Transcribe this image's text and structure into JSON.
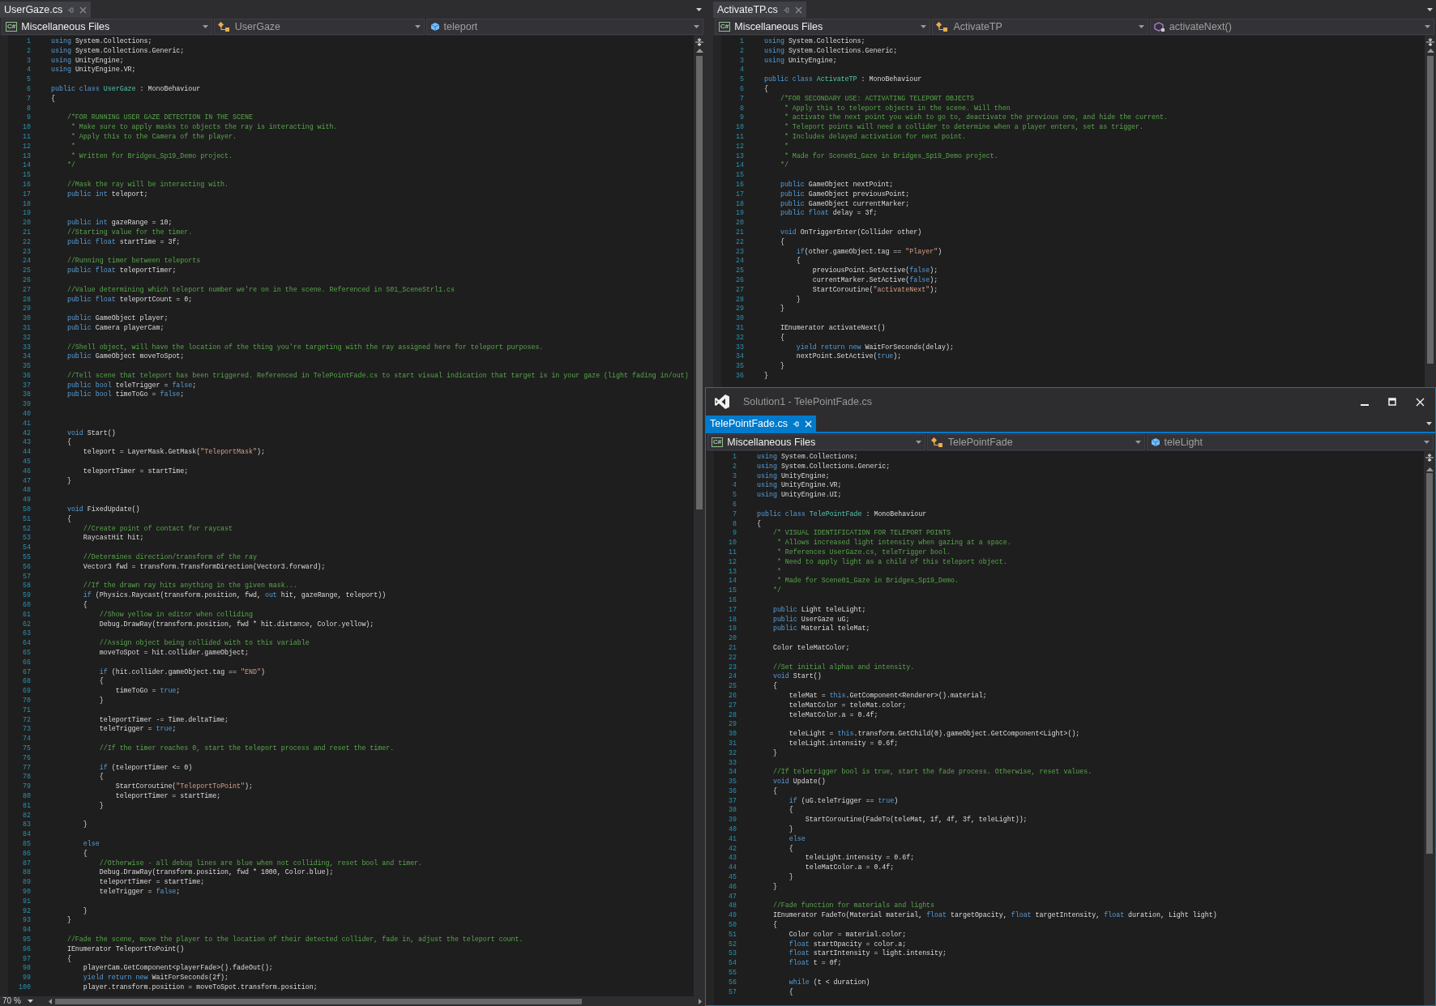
{
  "left_editor": {
    "tab": {
      "label": "UserGaze.cs",
      "selected": false
    },
    "nav": {
      "project_badge": "C#",
      "project": "Miscellaneous Files",
      "type": "UserGaze",
      "member": {
        "kind": "field",
        "label": "teleport"
      }
    },
    "lines": [
      {
        "number": "1",
        "segments": [
          {
            "kind": "keyword",
            "text": "using"
          },
          {
            "kind": "plain",
            "text": " System.Collections;"
          }
        ]
      },
      {
        "number": "2",
        "segments": [
          {
            "kind": "keyword",
            "text": "using"
          },
          {
            "kind": "plain",
            "text": " System.Collections.Generic;"
          }
        ]
      },
      {
        "number": "3",
        "segments": [
          {
            "kind": "keyword",
            "text": "using"
          },
          {
            "kind": "plain",
            "text": " UnityEngine;"
          }
        ]
      },
      {
        "number": "4",
        "segments": [
          {
            "kind": "keyword",
            "text": "using"
          },
          {
            "kind": "plain",
            "text": " UnityEngine.VR;"
          }
        ]
      },
      {
        "number": "5"
      },
      {
        "number": "6",
        "segments": [
          {
            "kind": "keyword",
            "text": "public class "
          },
          {
            "kind": "type",
            "text": "UserGaze"
          },
          {
            "kind": "plain",
            "text": " : MonoBehaviour"
          }
        ]
      },
      {
        "number": "7",
        "segments": [
          {
            "kind": "plain",
            "text": "{"
          }
        ]
      },
      {
        "number": "8"
      },
      {
        "number": "9",
        "segments": [
          {
            "kind": "comment",
            "text": "    /*FOR RUNNING USER GAZE DETECTION IN THE SCENE"
          }
        ]
      },
      {
        "number": "10",
        "segments": [
          {
            "kind": "comment",
            "text": "     * Make sure to apply masks to objects the ray is interacting with."
          }
        ]
      },
      {
        "number": "11",
        "segments": [
          {
            "kind": "comment",
            "text": "     * Apply this to the Camera of the player."
          }
        ]
      },
      {
        "number": "12",
        "segments": [
          {
            "kind": "comment",
            "text": "     *"
          }
        ]
      },
      {
        "number": "13",
        "segments": [
          {
            "kind": "comment",
            "text": "     * Written for Bridges_Sp19_Demo project."
          }
        ]
      },
      {
        "number": "14",
        "segments": [
          {
            "kind": "comment",
            "text": "    */"
          }
        ]
      },
      {
        "number": "15"
      },
      {
        "number": "16",
        "segments": [
          {
            "kind": "comment",
            "text": "    //Mask the ray will be interacting with."
          }
        ]
      },
      {
        "number": "17",
        "segments": [
          {
            "kind": "keyword",
            "text": "    public int"
          },
          {
            "kind": "plain",
            "text": " teleport;"
          }
        ]
      },
      {
        "number": "18"
      },
      {
        "number": "19"
      },
      {
        "number": "20",
        "segments": [
          {
            "kind": "keyword",
            "text": "    public int"
          },
          {
            "kind": "plain",
            "text": " gazeRange = 10;"
          }
        ]
      },
      {
        "number": "21",
        "segments": [
          {
            "kind": "comment",
            "text": "    //Starting value for the timer."
          }
        ]
      },
      {
        "number": "22",
        "segments": [
          {
            "kind": "keyword",
            "text": "    public float"
          },
          {
            "kind": "plain",
            "text": " startTime = 3f;"
          }
        ]
      },
      {
        "number": "23"
      },
      {
        "number": "24",
        "segments": [
          {
            "kind": "comment",
            "text": "    //Running timer between teleports"
          }
        ]
      },
      {
        "number": "25",
        "segments": [
          {
            "kind": "keyword",
            "text": "    public float"
          },
          {
            "kind": "plain",
            "text": " teleportTimer;"
          }
        ]
      },
      {
        "number": "26"
      },
      {
        "number": "27",
        "segments": [
          {
            "kind": "comment",
            "text": "    //Value determining which teleport number we're on in the scene. Referenced in S01_SceneStrl1.cs"
          }
        ]
      },
      {
        "number": "28",
        "segments": [
          {
            "kind": "keyword",
            "text": "    public float"
          },
          {
            "kind": "plain",
            "text": " teleportCount = 0;"
          }
        ]
      },
      {
        "number": "29"
      },
      {
        "number": "30",
        "segments": [
          {
            "kind": "keyword",
            "text": "    public"
          },
          {
            "kind": "plain",
            "text": " GameObject player;"
          }
        ]
      },
      {
        "number": "31",
        "segments": [
          {
            "kind": "keyword",
            "text": "    public"
          },
          {
            "kind": "plain",
            "text": " Camera playerCam;"
          }
        ]
      },
      {
        "number": "32"
      },
      {
        "number": "33",
        "segments": [
          {
            "kind": "comment",
            "text": "    //Shell object, will have the location of the thing you're targeting with the ray assigned here for teleport purposes."
          }
        ]
      },
      {
        "number": "34",
        "segments": [
          {
            "kind": "keyword",
            "text": "    public"
          },
          {
            "kind": "plain",
            "text": " GameObject moveToSpot;"
          }
        ]
      },
      {
        "number": "35"
      },
      {
        "number": "36",
        "segments": [
          {
            "kind": "comment",
            "text": "    //Tell scene that teleport has been triggered. Referenced in TelePointFade.cs to start visual indication that target is in your gaze (light fading in/out)"
          }
        ]
      },
      {
        "number": "37",
        "segments": [
          {
            "kind": "keyword",
            "text": "    public bool"
          },
          {
            "kind": "plain",
            "text": " teleTrigger = "
          },
          {
            "kind": "keyword",
            "text": "false"
          },
          {
            "kind": "plain",
            "text": ";"
          }
        ]
      },
      {
        "number": "38",
        "segments": [
          {
            "kind": "keyword",
            "text": "    public bool"
          },
          {
            "kind": "plain",
            "text": " timeToGo = "
          },
          {
            "kind": "keyword",
            "text": "false"
          },
          {
            "kind": "plain",
            "text": ";"
          }
        ]
      },
      {
        "number": "39"
      },
      {
        "number": "40"
      },
      {
        "number": "41"
      },
      {
        "number": "42",
        "segments": [
          {
            "kind": "keyword",
            "text": "    void"
          },
          {
            "kind": "plain",
            "text": " Start()"
          }
        ]
      },
      {
        "number": "43",
        "segments": [
          {
            "kind": "plain",
            "text": "    {"
          }
        ]
      },
      {
        "number": "44",
        "segments": [
          {
            "kind": "plain",
            "text": "        teleport = LayerMask.GetMask("
          },
          {
            "kind": "string",
            "text": "\"TeleportMask\""
          },
          {
            "kind": "plain",
            "text": ");"
          }
        ]
      },
      {
        "number": "45"
      },
      {
        "number": "46",
        "segments": [
          {
            "kind": "plain",
            "text": "        teleportTimer = startTime;"
          }
        ]
      },
      {
        "number": "47",
        "segments": [
          {
            "kind": "plain",
            "text": "    }"
          }
        ]
      },
      {
        "number": "48"
      },
      {
        "number": "49"
      },
      {
        "number": "50",
        "segments": [
          {
            "kind": "keyword",
            "text": "    void"
          },
          {
            "kind": "plain",
            "text": " FixedUpdate()"
          }
        ]
      },
      {
        "number": "51",
        "segments": [
          {
            "kind": "plain",
            "text": "    {"
          }
        ]
      },
      {
        "number": "52",
        "segments": [
          {
            "kind": "comment",
            "text": "        //Create point of contact for raycast"
          }
        ]
      },
      {
        "number": "53",
        "segments": [
          {
            "kind": "plain",
            "text": "        RaycastHit hit;"
          }
        ]
      },
      {
        "number": "54"
      },
      {
        "number": "55",
        "segments": [
          {
            "kind": "comment",
            "text": "        //Determines direction/transform of the ray"
          }
        ]
      },
      {
        "number": "56",
        "segments": [
          {
            "kind": "plain",
            "text": "        Vector3 fwd = transform.TransformDirection(Vector3.forward);"
          }
        ]
      },
      {
        "number": "57"
      },
      {
        "number": "58",
        "segments": [
          {
            "kind": "comment",
            "text": "        //If the drawn ray hits anything in the given mask..."
          }
        ]
      },
      {
        "number": "59",
        "segments": [
          {
            "kind": "keyword",
            "text": "        if"
          },
          {
            "kind": "plain",
            "text": " (Physics.Raycast(transform.position, fwd, "
          },
          {
            "kind": "keyword",
            "text": "out"
          },
          {
            "kind": "plain",
            "text": " hit, gazeRange, teleport))"
          }
        ]
      },
      {
        "number": "60",
        "segments": [
          {
            "kind": "plain",
            "text": "        {"
          }
        ]
      },
      {
        "number": "61",
        "segments": [
          {
            "kind": "comment",
            "text": "            //Show yellow in editor when colliding"
          }
        ]
      },
      {
        "number": "62",
        "segments": [
          {
            "kind": "plain",
            "text": "            Debug.DrawRay(transform.position, fwd * hit.distance, Color.yellow);"
          }
        ]
      },
      {
        "number": "63"
      },
      {
        "number": "64",
        "segments": [
          {
            "kind": "comment",
            "text": "            //Assign object being collided with to this variable"
          }
        ]
      },
      {
        "number": "65",
        "segments": [
          {
            "kind": "plain",
            "text": "            moveToSpot = hit.collider.gameObject;"
          }
        ]
      },
      {
        "number": "66"
      },
      {
        "number": "67",
        "segments": [
          {
            "kind": "keyword",
            "text": "            if"
          },
          {
            "kind": "plain",
            "text": " (hit.collider.gameObject.tag == "
          },
          {
            "kind": "string",
            "text": "\"END\""
          },
          {
            "kind": "plain",
            "text": ")"
          }
        ]
      },
      {
        "number": "68",
        "segments": [
          {
            "kind": "plain",
            "text": "            {"
          }
        ]
      },
      {
        "number": "69",
        "segments": [
          {
            "kind": "plain",
            "text": "                timeToGo = "
          },
          {
            "kind": "keyword",
            "text": "true"
          },
          {
            "kind": "plain",
            "text": ";"
          }
        ]
      },
      {
        "number": "70",
        "segments": [
          {
            "kind": "plain",
            "text": "            }"
          }
        ]
      },
      {
        "number": "71"
      },
      {
        "number": "72",
        "segments": [
          {
            "kind": "plain",
            "text": "            teleportTimer -= Time.deltaTime;"
          }
        ]
      },
      {
        "number": "73",
        "segments": [
          {
            "kind": "plain",
            "text": "            teleTrigger = "
          },
          {
            "kind": "keyword",
            "text": "true"
          },
          {
            "kind": "plain",
            "text": ";"
          }
        ]
      },
      {
        "number": "74"
      },
      {
        "number": "75",
        "segments": [
          {
            "kind": "comment",
            "text": "            //If the timer reaches 0, start the teleport process and reset the timer."
          }
        ]
      },
      {
        "number": "76"
      },
      {
        "number": "77",
        "segments": [
          {
            "kind": "keyword",
            "text": "            if"
          },
          {
            "kind": "plain",
            "text": " (teleportTimer <= 0)"
          }
        ]
      },
      {
        "number": "78",
        "segments": [
          {
            "kind": "plain",
            "text": "            {"
          }
        ]
      },
      {
        "number": "79",
        "segments": [
          {
            "kind": "plain",
            "text": "                StartCoroutine("
          },
          {
            "kind": "string",
            "text": "\"TeleportToPoint\""
          },
          {
            "kind": "plain",
            "text": ");"
          }
        ]
      },
      {
        "number": "80",
        "segments": [
          {
            "kind": "plain",
            "text": "                teleportTimer = startTime;"
          }
        ]
      },
      {
        "number": "81",
        "segments": [
          {
            "kind": "plain",
            "text": "            }"
          }
        ]
      },
      {
        "number": "82"
      },
      {
        "number": "83",
        "segments": [
          {
            "kind": "plain",
            "text": "        }"
          }
        ]
      },
      {
        "number": "84"
      },
      {
        "number": "85",
        "segments": [
          {
            "kind": "keyword",
            "text": "        else"
          }
        ]
      },
      {
        "number": "86",
        "segments": [
          {
            "kind": "plain",
            "text": "        {"
          }
        ]
      },
      {
        "number": "87",
        "segments": [
          {
            "kind": "comment",
            "text": "            //Otherwise - all debug lines are blue when not colliding, reset bool and timer."
          }
        ]
      },
      {
        "number": "88",
        "segments": [
          {
            "kind": "plain",
            "text": "            Debug.DrawRay(transform.position, fwd * 1000, Color.blue);"
          }
        ]
      },
      {
        "number": "89",
        "segments": [
          {
            "kind": "plain",
            "text": "            teleportTimer = startTime;"
          }
        ]
      },
      {
        "number": "90",
        "segments": [
          {
            "kind": "plain",
            "text": "            teleTrigger = "
          },
          {
            "kind": "keyword",
            "text": "false"
          },
          {
            "kind": "plain",
            "text": ";"
          }
        ]
      },
      {
        "number": "91"
      },
      {
        "number": "92",
        "segments": [
          {
            "kind": "plain",
            "text": "        }"
          }
        ]
      },
      {
        "number": "93",
        "segments": [
          {
            "kind": "plain",
            "text": "    }"
          }
        ]
      },
      {
        "number": "94"
      },
      {
        "number": "95",
        "segments": [
          {
            "kind": "comment",
            "text": "    //Fade the scene, move the player to the location of their detected collider, fade in, adjust the teleport count."
          }
        ]
      },
      {
        "number": "96",
        "segments": [
          {
            "kind": "plain",
            "text": "    IEnumerator TeleportToPoint()"
          }
        ]
      },
      {
        "number": "97",
        "segments": [
          {
            "kind": "plain",
            "text": "    {"
          }
        ]
      },
      {
        "number": "98",
        "segments": [
          {
            "kind": "plain",
            "text": "        playerCam.GetComponent<playerFade>().fadeOut();"
          }
        ]
      },
      {
        "number": "99",
        "segments": [
          {
            "kind": "keyword",
            "text": "        yield return new"
          },
          {
            "kind": "plain",
            "text": " WaitForSeconds(2f);"
          }
        ]
      },
      {
        "number": "100",
        "segments": [
          {
            "kind": "plain",
            "text": "        player.transform.position = moveToSpot.transform.position;"
          }
        ]
      }
    ],
    "zoom": "70 %"
  },
  "right_editor": {
    "tab": {
      "label": "ActivateTP.cs",
      "selected": false
    },
    "nav": {
      "project_badge": "C#",
      "project": "Miscellaneous Files",
      "type": "ActivateTP",
      "member": {
        "kind": "method",
        "label": "activateNext()"
      }
    },
    "lines": [
      {
        "number": "1",
        "segments": [
          {
            "kind": "keyword",
            "text": "using"
          },
          {
            "kind": "plain",
            "text": " System.Collections;"
          }
        ]
      },
      {
        "number": "2",
        "segments": [
          {
            "kind": "keyword",
            "text": "using"
          },
          {
            "kind": "plain",
            "text": " System.Collections.Generic;"
          }
        ]
      },
      {
        "number": "3",
        "segments": [
          {
            "kind": "keyword",
            "text": "using"
          },
          {
            "kind": "plain",
            "text": " UnityEngine;"
          }
        ]
      },
      {
        "number": "4"
      },
      {
        "number": "5",
        "segments": [
          {
            "kind": "keyword",
            "text": "public class "
          },
          {
            "kind": "type",
            "text": "ActivateTP"
          },
          {
            "kind": "plain",
            "text": " : MonoBehaviour"
          }
        ]
      },
      {
        "number": "6",
        "segments": [
          {
            "kind": "plain",
            "text": "{"
          }
        ]
      },
      {
        "number": "7",
        "segments": [
          {
            "kind": "comment",
            "text": "    /*FOR SECONDARY USE: ACTIVATING TELEPORT OBJECTS"
          }
        ]
      },
      {
        "number": "8",
        "segments": [
          {
            "kind": "comment",
            "text": "     * Apply this to teleport objects in the scene. Will then"
          }
        ]
      },
      {
        "number": "9",
        "segments": [
          {
            "kind": "comment",
            "text": "     * activate the next point you wish to go to, deactivate the previous one, and hide the current."
          }
        ]
      },
      {
        "number": "10",
        "segments": [
          {
            "kind": "comment",
            "text": "     * Teleport points will need a collider to determine when a player enters, set as trigger."
          }
        ]
      },
      {
        "number": "11",
        "segments": [
          {
            "kind": "comment",
            "text": "     * Includes delayed activation for next point."
          }
        ]
      },
      {
        "number": "12",
        "segments": [
          {
            "kind": "comment",
            "text": "     *"
          }
        ]
      },
      {
        "number": "13",
        "segments": [
          {
            "kind": "comment",
            "text": "     * Made for Scene01_Gaze in Bridges_Sp19_Demo project."
          }
        ]
      },
      {
        "number": "14",
        "segments": [
          {
            "kind": "comment",
            "text": "    */"
          }
        ]
      },
      {
        "number": "15"
      },
      {
        "number": "16",
        "segments": [
          {
            "kind": "keyword",
            "text": "    public"
          },
          {
            "kind": "plain",
            "text": " GameObject nextPoint;"
          }
        ]
      },
      {
        "number": "17",
        "segments": [
          {
            "kind": "keyword",
            "text": "    public"
          },
          {
            "kind": "plain",
            "text": " GameObject previousPoint;"
          }
        ]
      },
      {
        "number": "18",
        "segments": [
          {
            "kind": "keyword",
            "text": "    public"
          },
          {
            "kind": "plain",
            "text": " GameObject currentMarker;"
          }
        ]
      },
      {
        "number": "19",
        "segments": [
          {
            "kind": "keyword",
            "text": "    public float"
          },
          {
            "kind": "plain",
            "text": " delay = 3f;"
          }
        ]
      },
      {
        "number": "20"
      },
      {
        "number": "21",
        "segments": [
          {
            "kind": "keyword",
            "text": "    void"
          },
          {
            "kind": "plain",
            "text": " OnTriggerEnter(Collider other)"
          }
        ]
      },
      {
        "number": "22",
        "segments": [
          {
            "kind": "plain",
            "text": "    {"
          }
        ]
      },
      {
        "number": "23",
        "segments": [
          {
            "kind": "keyword",
            "text": "        if"
          },
          {
            "kind": "plain",
            "text": "(other.gameObject.tag == "
          },
          {
            "kind": "string",
            "text": "\"Player\""
          },
          {
            "kind": "plain",
            "text": ")"
          }
        ]
      },
      {
        "number": "24",
        "segments": [
          {
            "kind": "plain",
            "text": "        {"
          }
        ]
      },
      {
        "number": "25",
        "segments": [
          {
            "kind": "plain",
            "text": "            previousPoint.SetActive("
          },
          {
            "kind": "keyword",
            "text": "false"
          },
          {
            "kind": "plain",
            "text": ");"
          }
        ]
      },
      {
        "number": "26",
        "segments": [
          {
            "kind": "plain",
            "text": "            currentMarker.SetActive("
          },
          {
            "kind": "keyword",
            "text": "false"
          },
          {
            "kind": "plain",
            "text": ");"
          }
        ]
      },
      {
        "number": "27",
        "segments": [
          {
            "kind": "plain",
            "text": "            StartCoroutine("
          },
          {
            "kind": "string",
            "text": "\"activateNext\""
          },
          {
            "kind": "plain",
            "text": ");"
          }
        ]
      },
      {
        "number": "28",
        "segments": [
          {
            "kind": "plain",
            "text": "        }"
          }
        ]
      },
      {
        "number": "29",
        "segments": [
          {
            "kind": "plain",
            "text": "    }"
          }
        ]
      },
      {
        "number": "30"
      },
      {
        "number": "31",
        "segments": [
          {
            "kind": "plain",
            "text": "    IEnumerator activateNext()"
          }
        ]
      },
      {
        "number": "32",
        "segments": [
          {
            "kind": "plain",
            "text": "    {"
          }
        ]
      },
      {
        "number": "33",
        "segments": [
          {
            "kind": "keyword",
            "text": "        yield return new"
          },
          {
            "kind": "plain",
            "text": " WaitForSeconds(delay);"
          }
        ]
      },
      {
        "number": "34",
        "segments": [
          {
            "kind": "plain",
            "text": "        nextPoint.SetActive("
          },
          {
            "kind": "keyword",
            "text": "true"
          },
          {
            "kind": "plain",
            "text": ");"
          }
        ]
      },
      {
        "number": "35",
        "segments": [
          {
            "kind": "plain",
            "text": "    }"
          }
        ]
      },
      {
        "number": "36",
        "segments": [
          {
            "kind": "plain",
            "text": "}"
          }
        ]
      }
    ]
  },
  "floating_window": {
    "title": "Solution1 - TelePointFade.cs",
    "editor": {
      "tab": {
        "label": "TelePointFade.cs",
        "selected": true
      },
      "nav": {
        "project_badge": "C#",
        "project": "Miscellaneous Files",
        "type": "TelePointFade",
        "member": {
          "kind": "field",
          "label": "teleLight"
        }
      },
      "lines": [
        {
          "number": "1",
          "segments": [
            {
              "kind": "keyword",
              "text": "using"
            },
            {
              "kind": "plain",
              "text": " System.Collections;"
            }
          ]
        },
        {
          "number": "2",
          "segments": [
            {
              "kind": "keyword",
              "text": "using"
            },
            {
              "kind": "plain",
              "text": " System.Collections.Generic;"
            }
          ]
        },
        {
          "number": "3",
          "segments": [
            {
              "kind": "keyword",
              "text": "using"
            },
            {
              "kind": "plain",
              "text": " UnityEngine;"
            }
          ]
        },
        {
          "number": "4",
          "segments": [
            {
              "kind": "keyword",
              "text": "using"
            },
            {
              "kind": "plain",
              "text": " UnityEngine.VR;"
            }
          ]
        },
        {
          "number": "5",
          "segments": [
            {
              "kind": "keyword",
              "text": "using"
            },
            {
              "kind": "plain",
              "text": " UnityEngine.UI;"
            }
          ]
        },
        {
          "number": "6"
        },
        {
          "number": "7",
          "segments": [
            {
              "kind": "keyword",
              "text": "public class "
            },
            {
              "kind": "type",
              "text": "TelePointFade"
            },
            {
              "kind": "plain",
              "text": " : MonoBehaviour"
            }
          ]
        },
        {
          "number": "8",
          "segments": [
            {
              "kind": "plain",
              "text": "{"
            }
          ]
        },
        {
          "number": "9",
          "segments": [
            {
              "kind": "comment",
              "text": "    /* VISUAL IDENTIFICATION FOR TELEPORT POINTS"
            }
          ]
        },
        {
          "number": "10",
          "segments": [
            {
              "kind": "comment",
              "text": "     * Allows increased light intensity when gazing at a space."
            }
          ]
        },
        {
          "number": "11",
          "segments": [
            {
              "kind": "comment",
              "text": "     * References UserGaze.cs, teleTrigger bool."
            }
          ]
        },
        {
          "number": "12",
          "segments": [
            {
              "kind": "comment",
              "text": "     * Need to apply light as a child of this teleport object."
            }
          ]
        },
        {
          "number": "13",
          "segments": [
            {
              "kind": "comment",
              "text": "     *"
            }
          ]
        },
        {
          "number": "14",
          "segments": [
            {
              "kind": "comment",
              "text": "     * Made for Scene01_Gaze in Bridges_Sp19_Demo."
            }
          ]
        },
        {
          "number": "15",
          "segments": [
            {
              "kind": "comment",
              "text": "    */"
            }
          ]
        },
        {
          "number": "16"
        },
        {
          "number": "17",
          "segments": [
            {
              "kind": "keyword",
              "text": "    public"
            },
            {
              "kind": "plain",
              "text": " Light teleLight;"
            }
          ]
        },
        {
          "number": "18",
          "segments": [
            {
              "kind": "keyword",
              "text": "    public"
            },
            {
              "kind": "plain",
              "text": " UserGaze uG;"
            }
          ]
        },
        {
          "number": "19",
          "segments": [
            {
              "kind": "keyword",
              "text": "    public"
            },
            {
              "kind": "plain",
              "text": " Material teleMat;"
            }
          ]
        },
        {
          "number": "20"
        },
        {
          "number": "21",
          "segments": [
            {
              "kind": "plain",
              "text": "    Color teleMatColor;"
            }
          ]
        },
        {
          "number": "22"
        },
        {
          "number": "23",
          "segments": [
            {
              "kind": "comment",
              "text": "    //Set initial alphas and intensity."
            }
          ]
        },
        {
          "number": "24",
          "segments": [
            {
              "kind": "keyword",
              "text": "    void"
            },
            {
              "kind": "plain",
              "text": " Start()"
            }
          ]
        },
        {
          "number": "25",
          "segments": [
            {
              "kind": "plain",
              "text": "    {"
            }
          ]
        },
        {
          "number": "26",
          "segments": [
            {
              "kind": "plain",
              "text": "        teleMat = "
            },
            {
              "kind": "keyword",
              "text": "this"
            },
            {
              "kind": "plain",
              "text": ".GetComponent<Renderer>().material;"
            }
          ]
        },
        {
          "number": "27",
          "segments": [
            {
              "kind": "plain",
              "text": "        teleMatColor = teleMat.color;"
            }
          ]
        },
        {
          "number": "28",
          "segments": [
            {
              "kind": "plain",
              "text": "        teleMatColor.a = 0.4f;"
            }
          ]
        },
        {
          "number": "29"
        },
        {
          "number": "30",
          "segments": [
            {
              "kind": "plain",
              "text": "        teleLight = "
            },
            {
              "kind": "keyword",
              "text": "this"
            },
            {
              "kind": "plain",
              "text": ".transform.GetChild(0).gameObject.GetComponent<Light>();"
            }
          ]
        },
        {
          "number": "31",
          "segments": [
            {
              "kind": "plain",
              "text": "        teleLight.intensity = 0.6f;"
            }
          ]
        },
        {
          "number": "32",
          "segments": [
            {
              "kind": "plain",
              "text": "    }"
            }
          ]
        },
        {
          "number": "33"
        },
        {
          "number": "34",
          "segments": [
            {
              "kind": "comment",
              "text": "    //If teletrigger bool is true, start the fade process. Otherwise, reset values."
            }
          ]
        },
        {
          "number": "35",
          "segments": [
            {
              "kind": "keyword",
              "text": "    void"
            },
            {
              "kind": "plain",
              "text": " Update()"
            }
          ]
        },
        {
          "number": "36",
          "segments": [
            {
              "kind": "plain",
              "text": "    {"
            }
          ]
        },
        {
          "number": "37",
          "segments": [
            {
              "kind": "keyword",
              "text": "        if"
            },
            {
              "kind": "plain",
              "text": " (uG.teleTrigger == "
            },
            {
              "kind": "keyword",
              "text": "true"
            },
            {
              "kind": "plain",
              "text": ")"
            }
          ]
        },
        {
          "number": "38",
          "segments": [
            {
              "kind": "plain",
              "text": "        {"
            }
          ]
        },
        {
          "number": "39",
          "segments": [
            {
              "kind": "plain",
              "text": "            StartCoroutine(FadeTo(teleMat, 1f, 4f, 3f, teleLight));"
            }
          ]
        },
        {
          "number": "40",
          "segments": [
            {
              "kind": "plain",
              "text": "        }"
            }
          ]
        },
        {
          "number": "41",
          "segments": [
            {
              "kind": "keyword",
              "text": "        else"
            }
          ]
        },
        {
          "number": "42",
          "segments": [
            {
              "kind": "plain",
              "text": "        {"
            }
          ]
        },
        {
          "number": "43",
          "segments": [
            {
              "kind": "plain",
              "text": "            teleLight.intensity = 0.6f;"
            }
          ]
        },
        {
          "number": "44",
          "segments": [
            {
              "kind": "plain",
              "text": "            teleMatColor.a = 0.4f;"
            }
          ]
        },
        {
          "number": "45",
          "segments": [
            {
              "kind": "plain",
              "text": "        }"
            }
          ]
        },
        {
          "number": "46",
          "segments": [
            {
              "kind": "plain",
              "text": "    }"
            }
          ]
        },
        {
          "number": "47"
        },
        {
          "number": "48",
          "segments": [
            {
              "kind": "comment",
              "text": "    //Fade function for materials and lights"
            }
          ]
        },
        {
          "number": "49",
          "segments": [
            {
              "kind": "plain",
              "text": "    IEnumerator FadeTo(Material material, "
            },
            {
              "kind": "keyword",
              "text": "float"
            },
            {
              "kind": "plain",
              "text": " targetOpacity, "
            },
            {
              "kind": "keyword",
              "text": "float"
            },
            {
              "kind": "plain",
              "text": " targetIntensity, "
            },
            {
              "kind": "keyword",
              "text": "float"
            },
            {
              "kind": "plain",
              "text": " duration, Light light)"
            }
          ]
        },
        {
          "number": "50",
          "segments": [
            {
              "kind": "plain",
              "text": "    {"
            }
          ]
        },
        {
          "number": "51",
          "segments": [
            {
              "kind": "plain",
              "text": "        Color color = material.color;"
            }
          ]
        },
        {
          "number": "52",
          "segments": [
            {
              "kind": "keyword",
              "text": "        float"
            },
            {
              "kind": "plain",
              "text": " startOpacity = color.a;"
            }
          ]
        },
        {
          "number": "53",
          "segments": [
            {
              "kind": "keyword",
              "text": "        float"
            },
            {
              "kind": "plain",
              "text": " startIntensity = light.intensity;"
            }
          ]
        },
        {
          "number": "54",
          "segments": [
            {
              "kind": "keyword",
              "text": "        float"
            },
            {
              "kind": "plain",
              "text": " t = 0f;"
            }
          ]
        },
        {
          "number": "55"
        },
        {
          "number": "56",
          "segments": [
            {
              "kind": "keyword",
              "text": "        while"
            },
            {
              "kind": "plain",
              "text": " (t < duration)"
            }
          ]
        },
        {
          "number": "57",
          "segments": [
            {
              "kind": "plain",
              "text": "        {"
            }
          ]
        }
      ]
    }
  }
}
